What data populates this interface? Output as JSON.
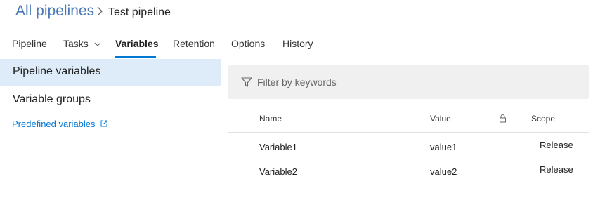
{
  "breadcrumb": {
    "root": "All pipelines",
    "current": "Test pipeline"
  },
  "tabs": [
    {
      "label": "Pipeline"
    },
    {
      "label": "Tasks"
    },
    {
      "label": "Variables",
      "active": true
    },
    {
      "label": "Retention"
    },
    {
      "label": "Options"
    },
    {
      "label": "History"
    }
  ],
  "sidebar": {
    "items": [
      {
        "label": "Pipeline variables",
        "selected": true
      },
      {
        "label": "Variable groups"
      }
    ],
    "link": {
      "label": "Predefined variables",
      "icon": "external-link-icon"
    }
  },
  "filter": {
    "placeholder": "Filter by keywords",
    "icon": "filter-icon"
  },
  "table": {
    "columns": [
      "Name",
      "Value",
      "",
      "Scope"
    ],
    "lock_icon": "lock-icon",
    "rows": [
      {
        "name": "Variable1",
        "value": "value1",
        "scope": "Release"
      },
      {
        "name": "Variable2",
        "value": "value2",
        "scope": "Release"
      }
    ]
  },
  "colors": {
    "accent": "#0078d4",
    "breadcrumb_link": "#4a7ab5",
    "selected_bg": "#deecf9",
    "filter_bg": "#f0f0f0"
  }
}
